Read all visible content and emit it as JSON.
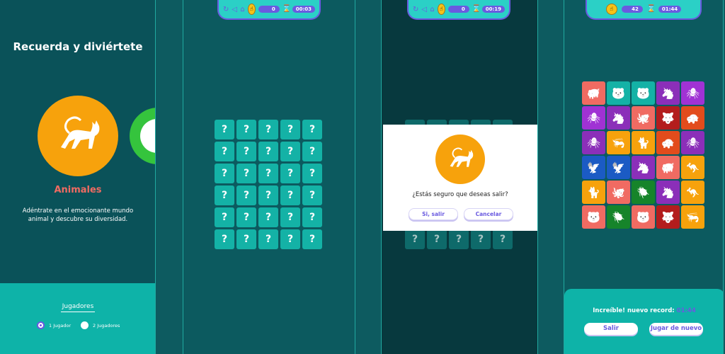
{
  "home": {
    "title": "Recuerda y diviértete",
    "category": "Animales",
    "description": "Adéntrate en el emocionante mundo animal y descubre su diversidad.",
    "players_label": "Jugadores",
    "options": [
      "1 Jugador",
      "2 Jugadores"
    ]
  },
  "game1": {
    "moves": "0",
    "time": "00:03",
    "tile_label": "?"
  },
  "game2": {
    "moves": "0",
    "time": "00:19",
    "tile_label": "?",
    "dialog": {
      "question": "¿Estás seguro que deseas salir?",
      "confirm": "Si, salir",
      "cancel": "Cancelar"
    }
  },
  "result": {
    "moves": "42",
    "time": "01:44",
    "record_text": "Increíble! nuevo record:",
    "record_time": "01:44",
    "exit": "Salir",
    "play_again": "Jugar de nuevo"
  },
  "colors": {
    "accent": "#6a5ae0",
    "teal": "#14b2a6",
    "orange": "#f7a20c",
    "coral": "#f06b62"
  },
  "cards": [
    {
      "c": "#f06b62",
      "i": "pig-icon"
    },
    {
      "c": "#14b2a6",
      "i": "bear-icon"
    },
    {
      "c": "#14b2a6",
      "i": "bear-icon"
    },
    {
      "c": "#8b2fb9",
      "i": "seahorse-icon"
    },
    {
      "c": "#a032d4",
      "i": "spider-icon"
    },
    {
      "c": "#a032d4",
      "i": "spider-icon"
    },
    {
      "c": "#8b2fb9",
      "i": "seahorse-icon"
    },
    {
      "c": "#f06b62",
      "i": "octopus-icon"
    },
    {
      "c": "#b31d1d",
      "i": "wolf-icon"
    },
    {
      "c": "#e24c1c",
      "i": "turtle-icon"
    },
    {
      "c": "#8b2fb9",
      "i": "spider-icon"
    },
    {
      "c": "#f7a20c",
      "i": "shrimp-icon"
    },
    {
      "c": "#f7a20c",
      "i": "cat-icon"
    },
    {
      "c": "#e24c1c",
      "i": "turtle-icon"
    },
    {
      "c": "#8b2fb9",
      "i": "spider-icon"
    },
    {
      "c": "#1b5bc4",
      "i": "eagle-icon"
    },
    {
      "c": "#1b5bc4",
      "i": "eagle-icon"
    },
    {
      "c": "#8b2fb9",
      "i": "seahorse-icon"
    },
    {
      "c": "#f06b62",
      "i": "pig-icon"
    },
    {
      "c": "#f7a20c",
      "i": "kangaroo-icon"
    },
    {
      "c": "#f7a20c",
      "i": "cat-icon"
    },
    {
      "c": "#f06b62",
      "i": "octopus-icon"
    },
    {
      "c": "#16842a",
      "i": "beetle-icon"
    },
    {
      "c": "#8b2fb9",
      "i": "seahorse-icon"
    },
    {
      "c": "#f7a20c",
      "i": "kangaroo-icon"
    },
    {
      "c": "#f06b62",
      "i": "bear-icon"
    },
    {
      "c": "#16842a",
      "i": "beetle-icon"
    },
    {
      "c": "#f06b62",
      "i": "bear-icon"
    },
    {
      "c": "#b31d1d",
      "i": "wolf-icon"
    },
    {
      "c": "#f7a20c",
      "i": "shrimp-icon"
    }
  ]
}
